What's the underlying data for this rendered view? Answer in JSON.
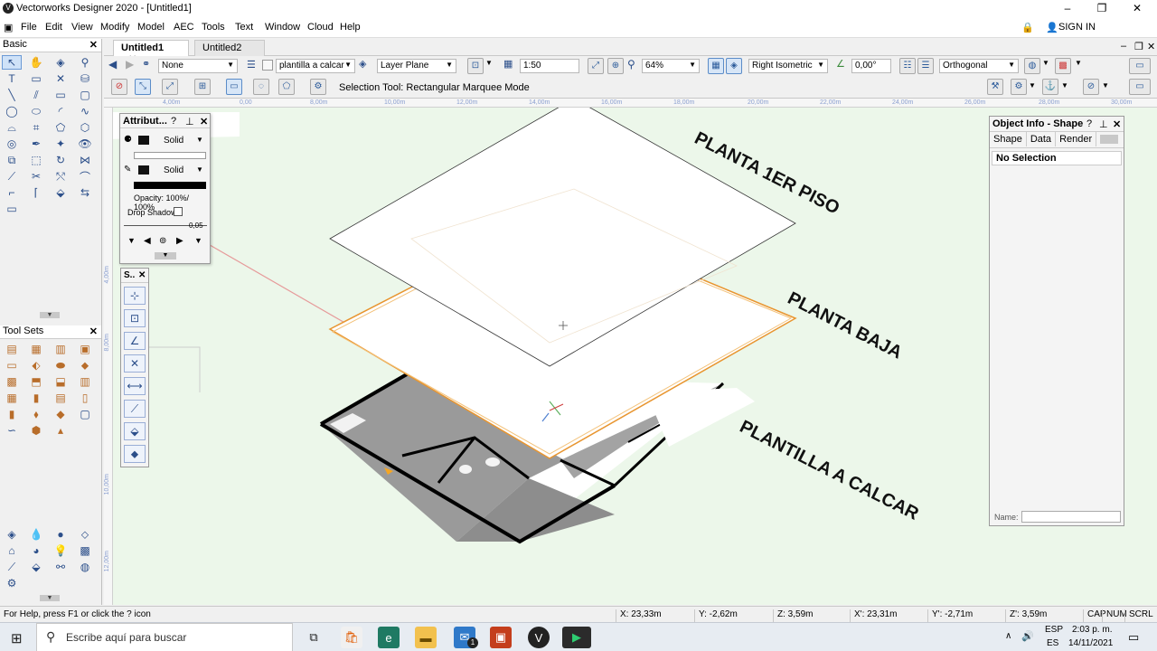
{
  "window": {
    "title": "Vectorworks Designer 2020 - [Untitled1]",
    "sign_in": "SIGN IN"
  },
  "menu": [
    "File",
    "Edit",
    "View",
    "Modify",
    "Model",
    "AEC",
    "Tools",
    "Text",
    "Window",
    "Cloud",
    "Help"
  ],
  "doc_tabs": [
    {
      "label": "Untitled1",
      "active": true
    },
    {
      "label": "Untitled2",
      "active": false
    }
  ],
  "view_bar": {
    "class_value": "None",
    "layer_value": "plantilla a calcar",
    "plane_value": "Layer Plane",
    "scale_value": "1:50",
    "zoom_value": "64%",
    "view_value": "Right Isometric",
    "angle_value": "0,00°",
    "projection_value": "Orthogonal"
  },
  "mode_bar": {
    "hint": "Selection Tool: Rectangular Marquee Mode"
  },
  "ruler": {
    "top_ticks": [
      "4,00m",
      "0,00",
      "8,00m",
      "10,00m",
      "12,00m",
      "14,00m",
      "16,00m",
      "18,00m",
      "20,00m",
      "22,00m",
      "24,00m",
      "26,00m",
      "28,00m",
      "30,00m"
    ],
    "left_ticks": [
      "4,00m",
      "8,00m",
      "10,00m",
      "12,00m"
    ]
  },
  "left_panel": {
    "basic_title": "Basic",
    "toolsets_title": "Tool Sets"
  },
  "attributes": {
    "title": "Attribut...",
    "fill_style": "Solid",
    "pen_style": "Solid",
    "opacity": "Opacity: 100%/ 100%",
    "drop_shadow": "Drop Shadow",
    "line_weight": "0,05"
  },
  "snapping": {
    "title": "S.."
  },
  "drawing": {
    "labels": [
      "PLANTA 1ER PISO",
      "PLANTA BAJA",
      "PLANTILLA A CALCAR"
    ],
    "colors": {
      "canvas": "#ecf7ea",
      "highlight": "#e8952f"
    }
  },
  "object_info": {
    "title": "Object Info - Shape",
    "tabs": [
      "Shape",
      "Data",
      "Render"
    ],
    "selection": "No Selection",
    "name_label": "Name:"
  },
  "status": {
    "help": "For Help, press F1 or click the ? icon",
    "coords": [
      "X: 23,33m",
      "Y: -2,62m",
      "Z: 3,59m",
      "X': 23,31m",
      "Y': -2,71m",
      "Z': 3,59m"
    ],
    "indicators": [
      "CAP",
      "NUM",
      "SCRL"
    ]
  },
  "taskbar": {
    "search_placeholder": "Escribe aquí para buscar",
    "lang": "ESP",
    "lang_sub": "ES",
    "time": "2:03 p. m.",
    "date": "14/11/2021",
    "mail_badge": "1"
  }
}
